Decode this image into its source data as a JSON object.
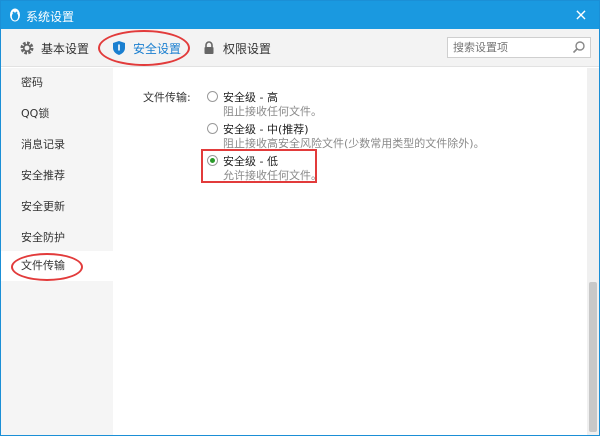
{
  "window": {
    "title": "系统设置",
    "close_label": "×"
  },
  "tabs": [
    {
      "label": "基本设置",
      "icon": "gear-icon"
    },
    {
      "label": "安全设置",
      "icon": "shield-icon",
      "active": true
    },
    {
      "label": "权限设置",
      "icon": "lock-icon"
    }
  ],
  "search": {
    "placeholder": "搜索设置项"
  },
  "sidebar": {
    "items": [
      {
        "label": "密码"
      },
      {
        "label": "QQ锁"
      },
      {
        "label": "消息记录"
      },
      {
        "label": "安全推荐"
      },
      {
        "label": "安全更新"
      },
      {
        "label": "安全防护"
      },
      {
        "label": "文件传输",
        "active": true
      }
    ]
  },
  "file_transfer": {
    "label": "文件传输:",
    "options": [
      {
        "title": "安全级 - 高",
        "desc": "阻止接收任何文件。",
        "checked": false
      },
      {
        "title": "安全级 - 中(推荐)",
        "desc": "阻止接收高安全风险文件(少数常用类型的文件除外)。",
        "checked": false
      },
      {
        "title": "安全级 - 低",
        "desc": "允许接收任何文件。",
        "checked": true
      }
    ]
  },
  "colors": {
    "accent": "#1a99e0",
    "annotation": "#e23b3b",
    "checked": "#2a9a2a"
  }
}
